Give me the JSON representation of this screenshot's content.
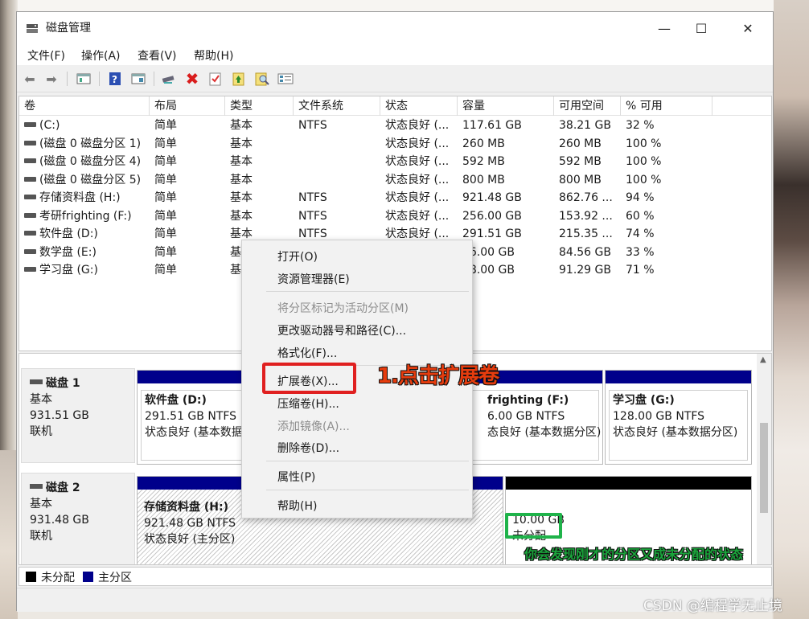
{
  "window": {
    "title": "磁盘管理"
  },
  "menu": [
    "文件(F)",
    "操作(A)",
    "查看(V)",
    "帮助(H)"
  ],
  "toolbar_icons": [
    "back-arrow-icon",
    "forward-arrow-icon",
    "properties-panel-icon",
    "help-icon",
    "view-panel-icon",
    "connect-icon",
    "delete-icon",
    "check-icon",
    "up-icon",
    "search-icon",
    "details-icon"
  ],
  "columns": [
    "卷",
    "布局",
    "类型",
    "文件系统",
    "状态",
    "容量",
    "可用空间",
    "% 可用"
  ],
  "volumes": [
    {
      "name": "(C:)",
      "layout": "简单",
      "type": "基本",
      "fs": "NTFS",
      "status": "状态良好 (...",
      "capacity": "117.61 GB",
      "free": "38.21 GB",
      "pct": "32 %"
    },
    {
      "name": "(磁盘 0 磁盘分区 1)",
      "layout": "简单",
      "type": "基本",
      "fs": "",
      "status": "状态良好 (...",
      "capacity": "260 MB",
      "free": "260 MB",
      "pct": "100 %"
    },
    {
      "name": "(磁盘 0 磁盘分区 4)",
      "layout": "简单",
      "type": "基本",
      "fs": "",
      "status": "状态良好 (...",
      "capacity": "592 MB",
      "free": "592 MB",
      "pct": "100 %"
    },
    {
      "name": "(磁盘 0 磁盘分区 5)",
      "layout": "简单",
      "type": "基本",
      "fs": "",
      "status": "状态良好 (...",
      "capacity": "800 MB",
      "free": "800 MB",
      "pct": "100 %"
    },
    {
      "name": "存储资料盘 (H:)",
      "layout": "简单",
      "type": "基本",
      "fs": "NTFS",
      "status": "状态良好 (...",
      "capacity": "921.48 GB",
      "free": "862.76 ...",
      "pct": "94 %"
    },
    {
      "name": "考研frighting (F:)",
      "layout": "简单",
      "type": "基本",
      "fs": "NTFS",
      "status": "状态良好 (...",
      "capacity": "256.00 GB",
      "free": "153.92 ...",
      "pct": "60 %"
    },
    {
      "name": "软件盘 (D:)",
      "layout": "简单",
      "type": "基本",
      "fs": "NTFS",
      "status": "状态良好 (...",
      "capacity": "291.51 GB",
      "free": "215.35 ...",
      "pct": "74 %"
    },
    {
      "name": "数学盘 (E:)",
      "layout": "简单",
      "type": "基",
      "fs": "",
      "status": "",
      "capacity": "56.00 GB",
      "free": "84.56 GB",
      "pct": "33 %"
    },
    {
      "name": "学习盘 (G:)",
      "layout": "简单",
      "type": "基",
      "fs": "",
      "status": "",
      "capacity": "28.00 GB",
      "free": "91.29 GB",
      "pct": "71 %"
    }
  ],
  "disks": [
    {
      "title": "磁盘 1",
      "kind": "基本",
      "size": "931.51 GB",
      "state": "联机",
      "partitions": [
        {
          "name": "软件盘 (D:)",
          "size": "291.51 GB NTFS",
          "status": "状态良好 (基本数据"
        },
        {
          "name": "frighting  (F:)",
          "size": "6.00 GB NTFS",
          "status": "态良好 (基本数据分区)"
        },
        {
          "name": "学习盘 (G:)",
          "size": "128.00 GB NTFS",
          "status": "状态良好 (基本数据分区)"
        }
      ]
    },
    {
      "title": "磁盘 2",
      "kind": "基本",
      "size": "931.48 GB",
      "state": "联机",
      "partitions": [
        {
          "name": "存储资料盘 (H:)",
          "size": "921.48 GB NTFS",
          "status": "状态良好 (主分区)"
        },
        {
          "name": "",
          "size": "10.00 GB",
          "status": "未分配"
        }
      ]
    }
  ],
  "legend": [
    {
      "label": "未分配",
      "color": "#000000"
    },
    {
      "label": "主分区",
      "color": "#00008b"
    }
  ],
  "context_menu": {
    "open": "打开(O)",
    "explorer": "资源管理器(E)",
    "mark_active": "将分区标记为活动分区(M)",
    "change_letter": "更改驱动器号和路径(C)...",
    "format": "格式化(F)...",
    "extend": "扩展卷(X)...",
    "shrink": "压缩卷(H)...",
    "mirror": "添加镜像(A)...",
    "delete": "删除卷(D)...",
    "properties": "属性(P)",
    "help": "帮助(H)"
  },
  "annotations": {
    "step1": "1.点击扩展卷",
    "note": "你会发现刚才的分区又成未分配的状态",
    "watermark": "CSDN @编程学无止境"
  },
  "colors": {
    "primary_partition": "#00008b",
    "unallocated": "#000000",
    "highlight_red": "#e02020",
    "highlight_green": "#1fb34a"
  }
}
